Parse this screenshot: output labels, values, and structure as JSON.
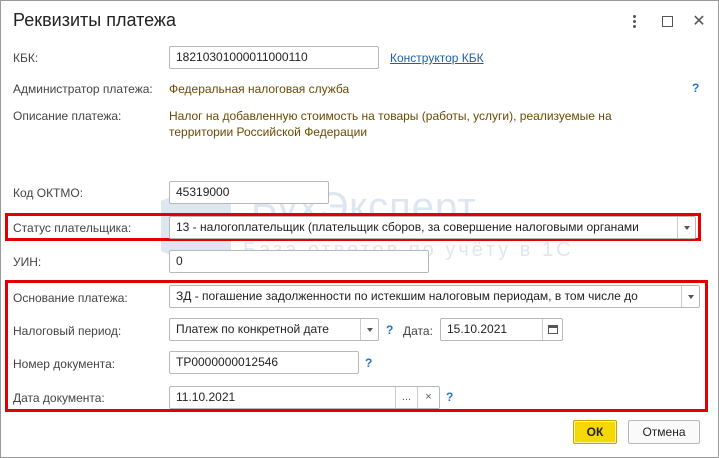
{
  "window": {
    "title": "Реквизиты платежа"
  },
  "kbk": {
    "label": "КБК:",
    "value": "18210301000011000110",
    "constructor_link": "Конструктор КБК"
  },
  "admin": {
    "label": "Администратор платежа:",
    "value": "Федеральная налоговая служба"
  },
  "description": {
    "label": "Описание платежа:",
    "value": "Налог на добавленную стоимость на товары (работы, услуги), реализуемые на территории Российской Федерации"
  },
  "oktmo": {
    "label": "Код ОКТМО:",
    "value": "45319000"
  },
  "payer_status": {
    "label": "Статус плательщика:",
    "value": "13 - налогоплательщик (плательщик сборов, за совершение налоговыми органами"
  },
  "uin": {
    "label": "УИН:",
    "value": "0"
  },
  "basis": {
    "label": "Основание платежа:",
    "value": "ЗД - погашение задолженности по истекшим налоговым периодам, в том числе до"
  },
  "tax_period": {
    "label": "Налоговый период:",
    "value": "Платеж по конкретной дате",
    "date_label": "Дата:",
    "date_value": "15.10.2021"
  },
  "doc_number": {
    "label": "Номер документа:",
    "value": "ТР0000000012546"
  },
  "doc_date": {
    "label": "Дата документа:",
    "value": "11.10.2021"
  },
  "buttons": {
    "ok": "ОК",
    "cancel": "Отмена",
    "ellipsis": "...",
    "clear": "×"
  },
  "help_mark": "?",
  "watermark": {
    "line1": "БухЭксперт",
    "line2": "База ответов по учёту в 1С"
  },
  "colors": {
    "highlight": "#e00000",
    "ok_button": "#f5d800",
    "value_text": "#6b4a00",
    "help": "#2a73c4"
  }
}
